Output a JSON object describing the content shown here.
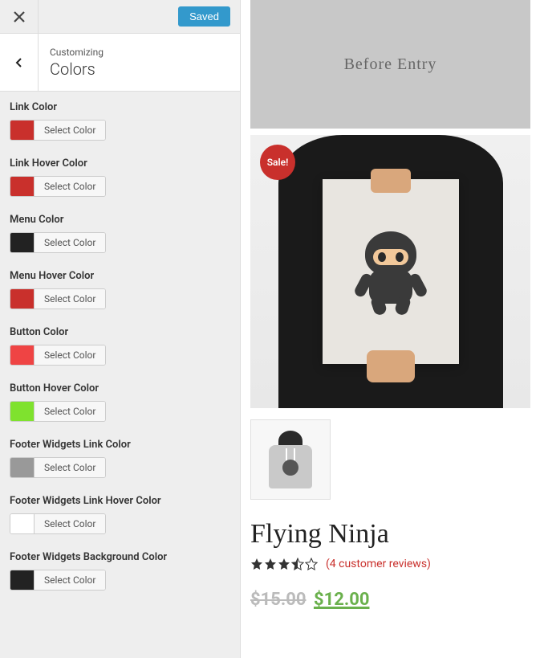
{
  "topbar": {
    "saved_label": "Saved"
  },
  "header": {
    "breadcrumb": "Customizing",
    "title": "Colors"
  },
  "select_color_label": "Select Color",
  "controls": [
    {
      "key": "link_color",
      "label": "Link Color",
      "color": "#c9302c"
    },
    {
      "key": "link_hover_color",
      "label": "Link Hover Color",
      "color": "#c9302c"
    },
    {
      "key": "menu_color",
      "label": "Menu Color",
      "color": "#222222"
    },
    {
      "key": "menu_hover_color",
      "label": "Menu Hover Color",
      "color": "#c9302c"
    },
    {
      "key": "button_color",
      "label": "Button Color",
      "color": "#ef4444"
    },
    {
      "key": "button_hover_color",
      "label": "Button Hover Color",
      "color": "#7fe22e"
    },
    {
      "key": "footer_widgets_link_color",
      "label": "Footer Widgets Link Color",
      "color": "#999999"
    },
    {
      "key": "footer_widgets_link_hover_color",
      "label": "Footer Widgets Link Hover Color",
      "color": "#ffffff"
    },
    {
      "key": "footer_widgets_background_color",
      "label": "Footer Widgets Background Color",
      "color": "#222222"
    }
  ],
  "preview": {
    "before_entry_text": "Before Entry",
    "sale_badge": "Sale!",
    "product_title": "Flying Ninja",
    "rating": 3.5,
    "reviews_text": "(4 customer reviews)",
    "price_old": "$15.00",
    "price_new": "$12.00"
  }
}
